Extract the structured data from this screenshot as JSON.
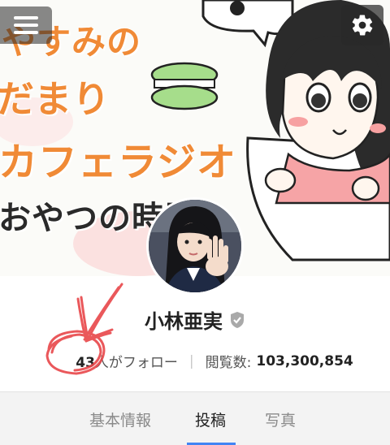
{
  "cover": {
    "title_line1": "やすみの",
    "title_line2": "だまり",
    "title_line3": "カフェラジオ",
    "title_line4": "おやつの時間"
  },
  "profile": {
    "name": "小林亜実",
    "followers_count": "43",
    "followers_unit": "人がフォロー",
    "divider": "|",
    "views_label": "閲覧数:",
    "views_value": "103,300,854"
  },
  "tabs": [
    {
      "label": "基本情報",
      "selected": false
    },
    {
      "label": "投稿",
      "selected": true
    },
    {
      "label": "写真",
      "selected": false
    }
  ],
  "colors": {
    "accent": "#4285f4",
    "annotation": "#e8474a",
    "title_orange": "#f08a36"
  },
  "icons": {
    "menu": "menu-icon",
    "settings": "gear-icon",
    "verified": "verified-check-icon"
  }
}
